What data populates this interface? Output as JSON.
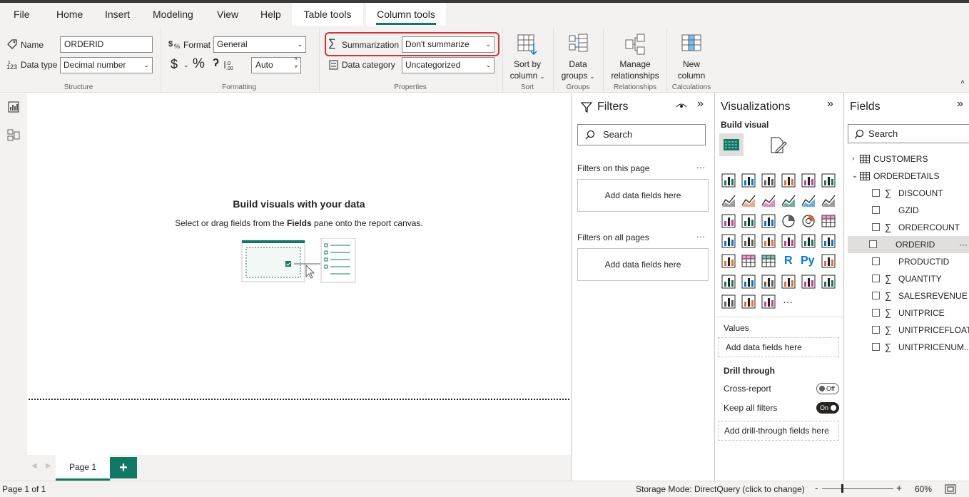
{
  "menu": {
    "file": "File",
    "home": "Home",
    "insert": "Insert",
    "modeling": "Modeling",
    "view": "View",
    "help": "Help",
    "table_tools": "Table tools",
    "column_tools": "Column tools"
  },
  "ribbon": {
    "structure": {
      "name_label": "Name",
      "name_value": "ORDERID",
      "datatype_label": "Data type",
      "datatype_value": "Decimal number",
      "group": "Structure"
    },
    "formatting": {
      "format_label": "Format",
      "format_value": "General",
      "currency_symbol": "$",
      "percent_symbol": "%",
      "comma_symbol": "ʔ",
      "decimals_value": "Auto",
      "group": "Formatting"
    },
    "properties": {
      "summarization_label": "Summarization",
      "summarization_value": "Don't summarize",
      "datacategory_label": "Data category",
      "datacategory_value": "Uncategorized",
      "group": "Properties"
    },
    "sort": {
      "btn_line1": "Sort by",
      "btn_line2": "column",
      "group": "Sort"
    },
    "groups": {
      "btn_line1": "Data",
      "btn_line2": "groups",
      "group": "Groups"
    },
    "relationships": {
      "btn_line1": "Manage",
      "btn_line2": "relationships",
      "group": "Relationships"
    },
    "calculations": {
      "btn_line1": "New",
      "btn_line2": "column",
      "group": "Calculations"
    },
    "highlight_color": "#d13438",
    "accent": "#117865"
  },
  "canvas": {
    "heading": "Build visuals with your data",
    "sub_pre": "Select or drag fields from the ",
    "sub_bold": "Fields",
    "sub_post": " pane onto the report canvas."
  },
  "pages": {
    "tab": "Page 1",
    "add": "+"
  },
  "filters": {
    "title": "Filters",
    "search_placeholder": "Search",
    "on_page": "Filters on this page",
    "on_all": "Filters on all pages",
    "add_fields": "Add data fields here",
    "more": "..."
  },
  "visualizations": {
    "title": "Visualizations",
    "build_visual": "Build visual",
    "values_label": "Values",
    "values_drop": "Add data fields here",
    "drill_through": "Drill through",
    "cross_report": "Cross-report",
    "cross_report_state": "Off",
    "keep_filters": "Keep all filters",
    "keep_filters_state": "On",
    "drill_drop": "Add drill-through fields here",
    "more_visuals": "···",
    "r_label": "R",
    "py_label": "Py",
    "icons": [
      "stacked-bar-icon",
      "stacked-column-icon",
      "clustered-bar-icon",
      "clustered-column-icon",
      "100-bar-icon",
      "100-column-icon",
      "line-chart-icon",
      "area-chart-icon",
      "stacked-area-icon",
      "line-column-icon",
      "line-clustered-icon",
      "ribbon-chart-icon",
      "waterfall-icon",
      "funnel-icon",
      "scatter-icon",
      "pie-icon",
      "donut-icon",
      "treemap-icon",
      "map-icon",
      "filled-map-icon",
      "gauge-icon",
      "card-icon",
      "multirow-card-icon",
      "kpi-icon",
      "slicer-icon",
      "table-icon",
      "matrix-icon",
      "r-visual-icon",
      "python-visual-icon",
      "key-influencers-icon",
      "decomposition-tree-icon",
      "qa-icon",
      "narrative-icon",
      "goals-icon",
      "paginated-report-icon",
      "arcgis-icon",
      "power-apps-icon",
      "power-automate-icon",
      "html-content-icon",
      "more-visuals-icon"
    ]
  },
  "fields": {
    "title": "Fields",
    "search_placeholder": "Search",
    "tables": [
      {
        "name": "CUSTOMERS",
        "expanded": false
      },
      {
        "name": "ORDERDETAILS",
        "expanded": true
      }
    ],
    "columns": [
      {
        "name": "DISCOUNT",
        "sigma": true
      },
      {
        "name": "GZID",
        "sigma": false
      },
      {
        "name": "ORDERCOUNT",
        "sigma": true
      },
      {
        "name": "ORDERID",
        "sigma": false,
        "selected": true
      },
      {
        "name": "PRODUCTID",
        "sigma": false
      },
      {
        "name": "QUANTITY",
        "sigma": true
      },
      {
        "name": "SALESREVENUE",
        "sigma": true
      },
      {
        "name": "UNITPRICE",
        "sigma": true
      },
      {
        "name": "UNITPRICEFLOAT",
        "sigma": true
      },
      {
        "name": "UNITPRICENUM...",
        "sigma": true
      }
    ],
    "sigma_symbol": "∑",
    "more": "···"
  },
  "status": {
    "page": "Page 1 of 1",
    "storage": "Storage Mode: DirectQuery (click to change)",
    "zoom_minus": "-",
    "zoom_plus": "+",
    "zoom_value": "60%",
    "zoom_level": 0.6
  }
}
